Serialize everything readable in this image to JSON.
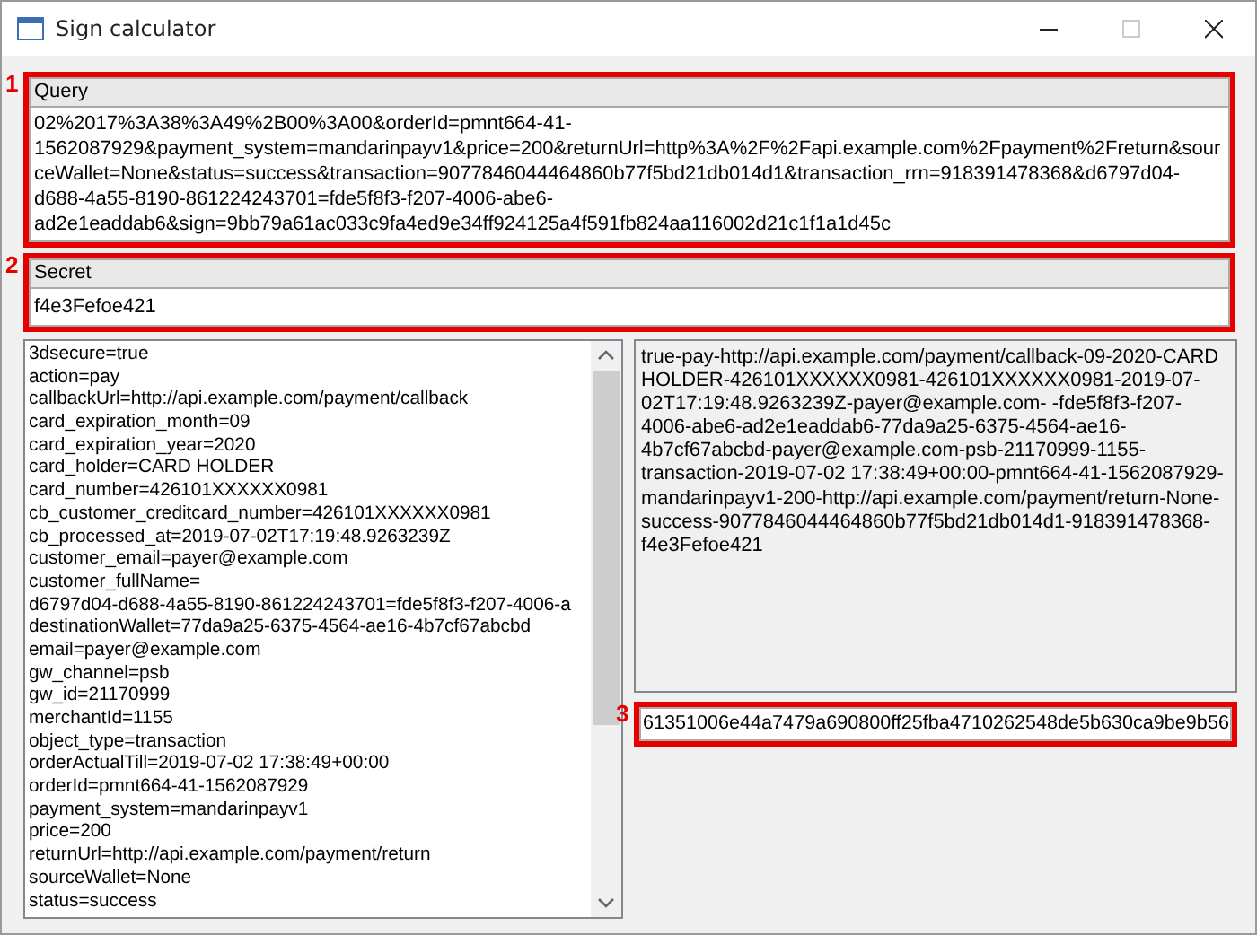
{
  "window": {
    "title": "Sign calculator",
    "buttons": [
      {
        "kind": "minimize",
        "disabled": false
      },
      {
        "kind": "maximize",
        "disabled": true
      },
      {
        "kind": "close",
        "disabled": false
      }
    ]
  },
  "query": {
    "marker": "1",
    "label": "Query",
    "value": "02%2017%3A38%3A49%2B00%3A00&orderId=pmnt664-41-1562087929&payment_system=mandarinpayv1&price=200&returnUrl=http%3A%2F%2Fapi.example.com%2Fpayment%2Freturn&sourceWallet=None&status=success&transaction=9077846044464860b77f5bd21db014d1&transaction_rrn=918391478368&d6797d04-d688-4a55-8190-861224243701=fde5f8f3-f207-4006-abe6-ad2e1eaddab6&sign=9bb79a61ac033c9fa4ed9e34ff924125a4f591fb824aa116002d21c1f1a1d45c"
  },
  "secret": {
    "marker": "2",
    "label": "Secret",
    "value": "f4e3Fefoe421"
  },
  "parameters": [
    "3dsecure=true",
    "action=pay",
    "callbackUrl=http://api.example.com/payment/callback",
    "card_expiration_month=09",
    "card_expiration_year=2020",
    "card_holder=CARD HOLDER",
    "card_number=426101XXXXXX0981",
    "cb_customer_creditcard_number=426101XXXXXX0981",
    "cb_processed_at=2019-07-02T17:19:48.9263239Z",
    "customer_email=payer@example.com",
    "customer_fullName=",
    "d6797d04-d688-4a55-8190-861224243701=fde5f8f3-f207-4006-a",
    "destinationWallet=77da9a25-6375-4564-ae16-4b7cf67abcbd",
    "email=payer@example.com",
    "gw_channel=psb",
    "gw_id=21170999",
    "merchantId=1155",
    "object_type=transaction",
    "orderActualTill=2019-07-02 17:38:49+00:00",
    "orderId=pmnt664-41-1562087929",
    "payment_system=mandarinpayv1",
    "price=200",
    "returnUrl=http://api.example.com/payment/return",
    "sourceWallet=None",
    "status=success"
  ],
  "sign_string": "true-pay-http://api.example.com/payment/callback-09-2020-CARD HOLDER-426101XXXXXX0981-426101XXXXXX0981-2019-07-02T17:19:48.9263239Z-payer@example.com-  -fde5f8f3-f207-4006-abe6-ad2e1eaddab6-77da9a25-6375-4564-ae16-4b7cf67abcbd-payer@example.com-psb-21170999-1155-transaction-2019-07-02 17:38:49+00:00-pmnt664-41-1562087929-mandarinpayv1-200-http://api.example.com/payment/return-None-success-9077846044464860b77f5bd21db014d1-918391478368-f4e3Fefoe421",
  "hash": {
    "marker": "3",
    "value": "61351006e44a7479a690800ff25fba4710262548de5b630ca9be9b56"
  }
}
